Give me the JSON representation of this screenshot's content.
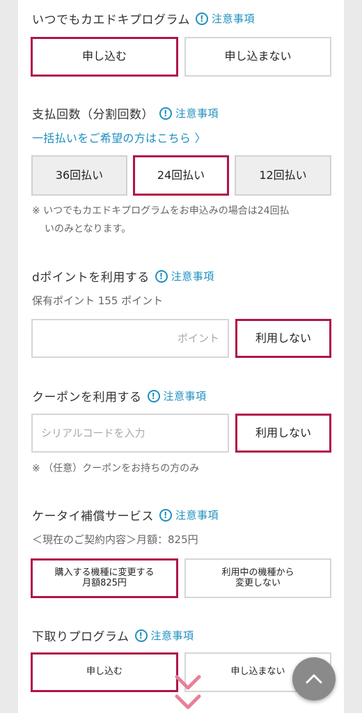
{
  "program": {
    "title": "いつでもカエドキプログラム",
    "notice_label": "注意事項",
    "options": [
      "申し込む",
      "申し込まない"
    ],
    "selected_index": 0
  },
  "installments": {
    "title": "支払回数（分割回数）",
    "notice_label": "注意事項",
    "lump_sum_link": "一括払いをご希望の方はこちら 〉",
    "options": [
      "36回払い",
      "24回払い",
      "12回払い"
    ],
    "selected_index": 1,
    "note_line1": "※ いつでもカエドキプログラムをお申込みの場合は24回払",
    "note_line2": "いのみとなります。"
  },
  "dpoint": {
    "title": "dポイントを利用する",
    "notice_label": "注意事項",
    "balance_text": "保有ポイント 155 ポイント",
    "input_placeholder": "ポイント",
    "input_value": "",
    "button_label": "利用しない"
  },
  "coupon": {
    "title": "クーポンを利用する",
    "notice_label": "注意事項",
    "input_placeholder": "シリアルコードを入力",
    "input_value": "",
    "button_label": "利用しない",
    "note": "※ （任意）クーポンをお持ちの方のみ"
  },
  "insurance": {
    "title": "ケータイ補償サービス",
    "notice_label": "注意事項",
    "current_contract": "＜現在のご契約内容＞月額：825円",
    "option1_line1": "購入する機種に変更する",
    "option1_line2": "月額825円",
    "option2_line1": "利用中の機種から",
    "option2_line2": "変更しない",
    "selected_index": 0
  },
  "tradein": {
    "title": "下取りプログラム",
    "notice_label": "注意事項",
    "options": [
      "申し込む",
      "申し込まない"
    ],
    "selected_index": 0
  },
  "colors": {
    "accent": "#b01447",
    "link": "#1f8fbf",
    "chevron": "#e8809a"
  },
  "icons": {
    "notice": "info-circle-icon",
    "scroll_top": "chevron-up-icon",
    "scroll_hint": "double-chevron-down-icon"
  }
}
